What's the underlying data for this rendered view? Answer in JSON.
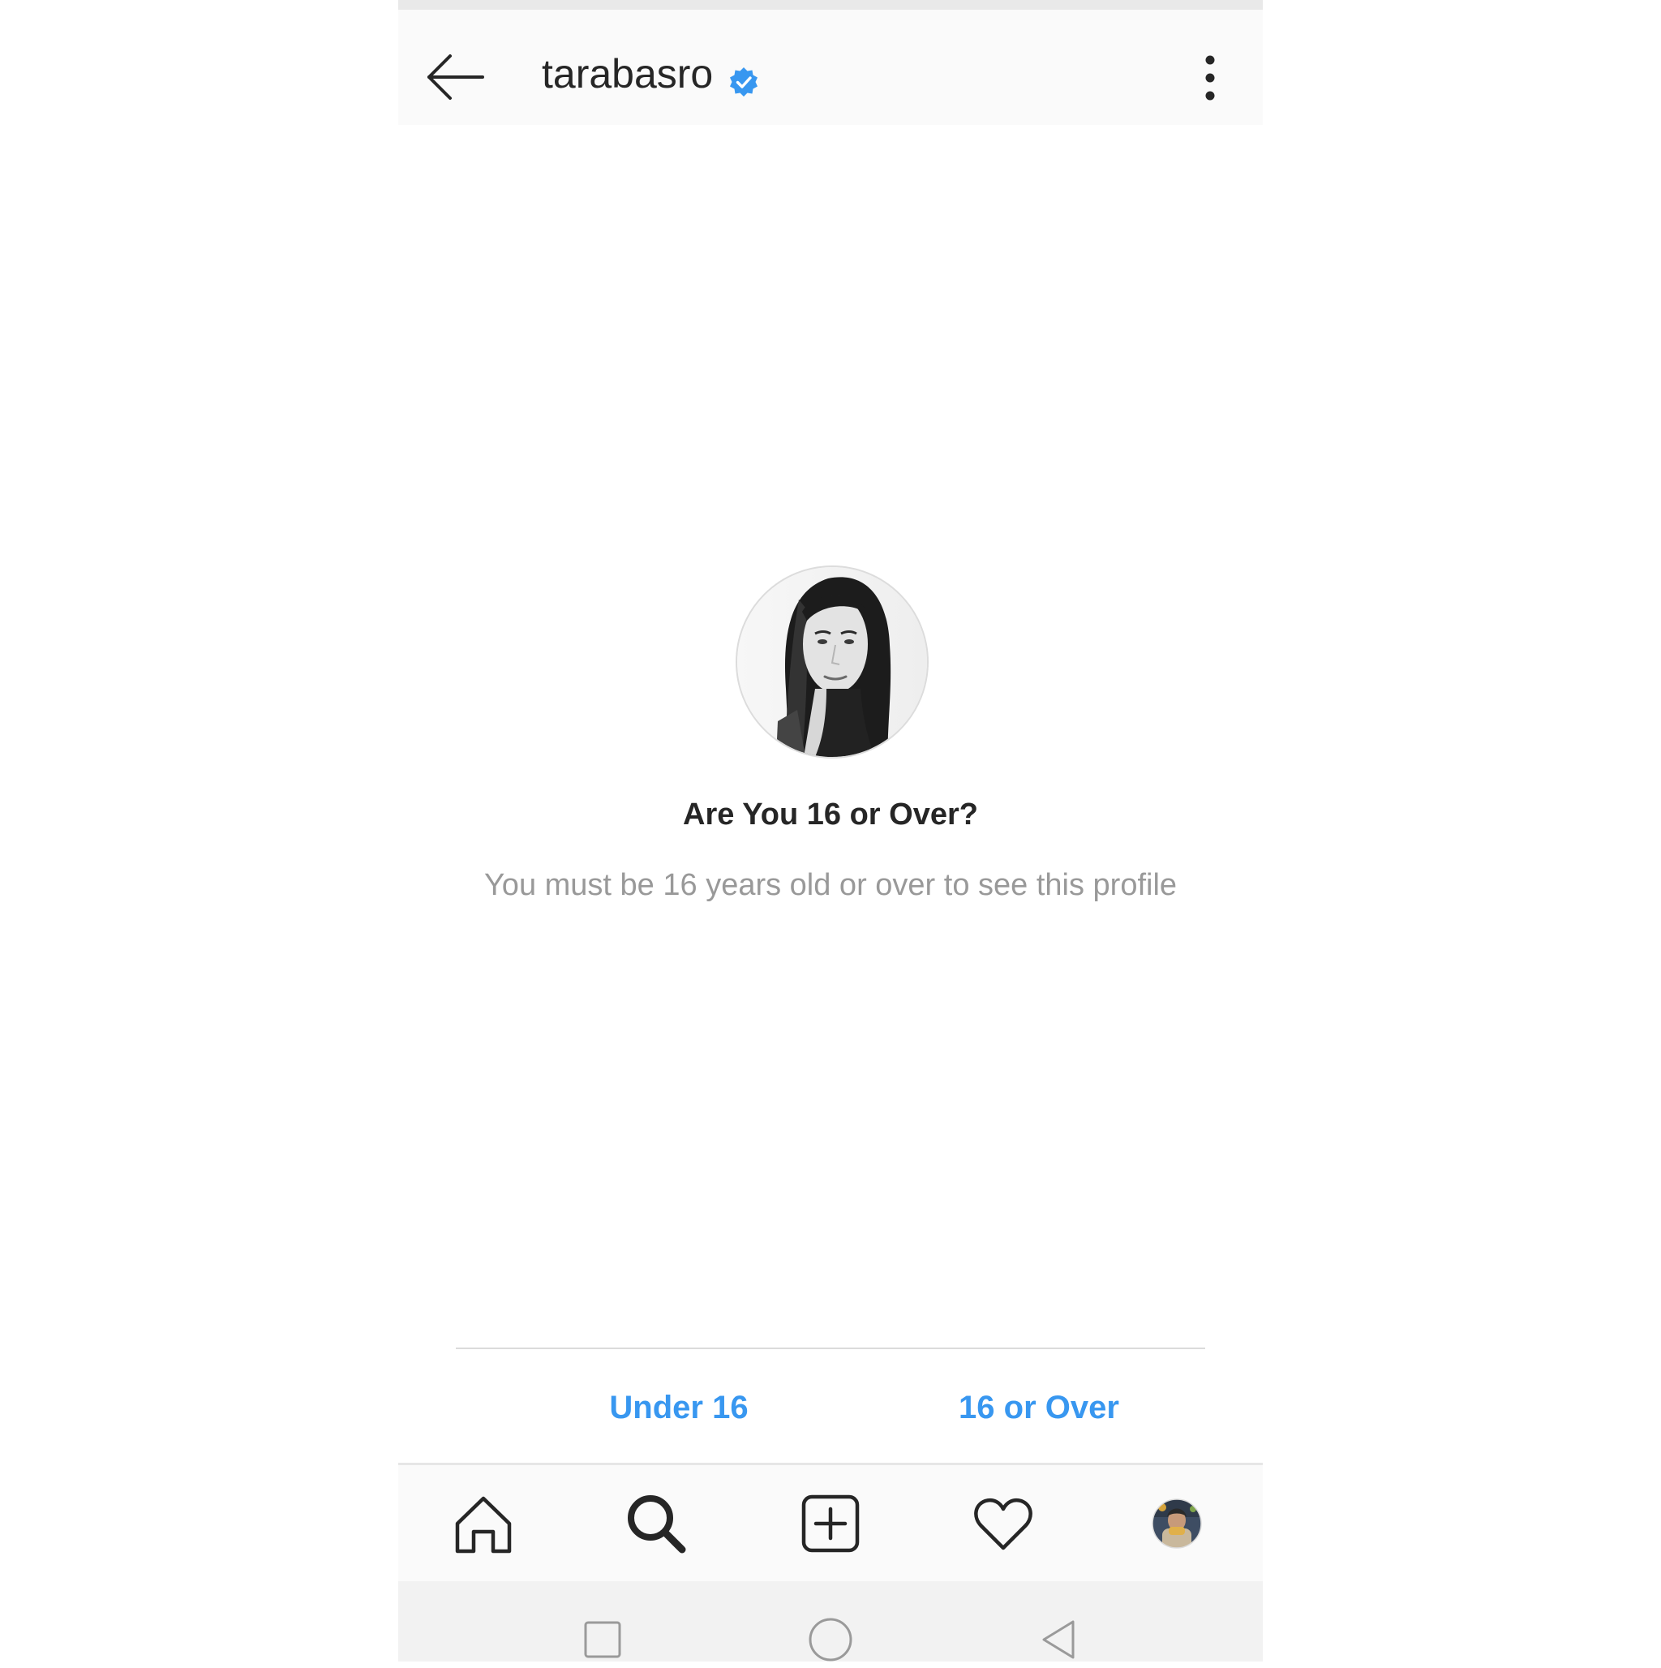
{
  "header": {
    "username": "tarabasro",
    "back_icon": "arrow-left-icon",
    "verified_icon": "verified-badge-icon",
    "more_icon": "more-vertical-icon",
    "verified_color": "#3897f0"
  },
  "age_gate": {
    "avatar_icon": "profile-photo",
    "title": "Are You 16 or Over?",
    "subtitle": "You must be 16 years old or over to see this profile",
    "under_label": "Under 16",
    "over_label": "16 or Over",
    "accent_color": "#3897f0"
  },
  "tab_bar": {
    "tabs": [
      {
        "icon": "home-icon"
      },
      {
        "icon": "search-icon",
        "selected": true
      },
      {
        "icon": "add-post-icon"
      },
      {
        "icon": "heart-icon"
      },
      {
        "icon": "profile-avatar-icon"
      }
    ]
  },
  "system_nav": {
    "buttons": [
      "recents-square-icon",
      "home-circle-icon",
      "back-triangle-icon"
    ]
  }
}
